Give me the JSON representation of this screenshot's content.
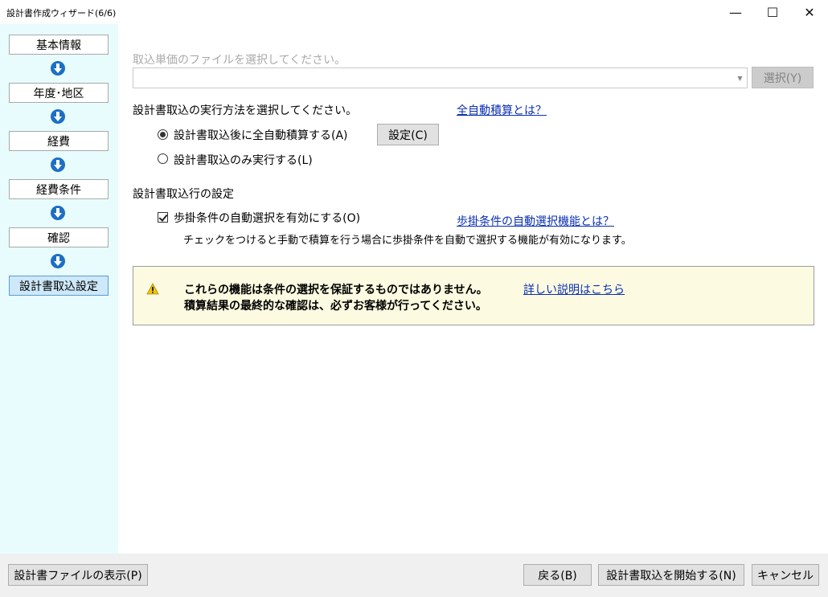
{
  "window": {
    "title": "設計書作成ウィザード(6/6)",
    "minimize": "—",
    "maximize": "☐",
    "close": "✕"
  },
  "sidebar": {
    "steps": [
      "基本情報",
      "年度･地区",
      "経費",
      "経費条件",
      "確認",
      "設計書取込設定"
    ],
    "active_index": 5
  },
  "file_section": {
    "prompt": "取込単価のファイルを選択してください。",
    "combo_value": "",
    "select_button": "選択(Y)"
  },
  "method_section": {
    "prompt": "設計書取込の実行方法を選択してください。",
    "help_link": "全自動積算とは？",
    "options": [
      {
        "label": "設計書取込後に全自動積算する(A)",
        "checked": true
      },
      {
        "label": "設計書取込のみ実行する(L)",
        "checked": false
      }
    ],
    "settings_button": "設定(C)"
  },
  "import_settings": {
    "heading": "設計書取込行の設定",
    "checkbox_label": "歩掛条件の自動選択を有効にする(O)",
    "checkbox_checked": true,
    "help_link": "歩掛条件の自動選択機能とは？",
    "description": "チェックをつけると手動で積算を行う場合に歩掛条件を自動で選択する機能が有効になります。"
  },
  "notice": {
    "line1": "これらの機能は条件の選択を保証するものではありません。",
    "line2": "積算結果の最終的な確認は、必ずお客様が行ってください。",
    "link": "詳しい説明はこちら",
    "icon": "warning-icon"
  },
  "footer": {
    "show_file": "設計書ファイルの表示(P)",
    "back": "戻る(B)",
    "start": "設計書取込を開始する(N)",
    "cancel": "キャンセル"
  }
}
